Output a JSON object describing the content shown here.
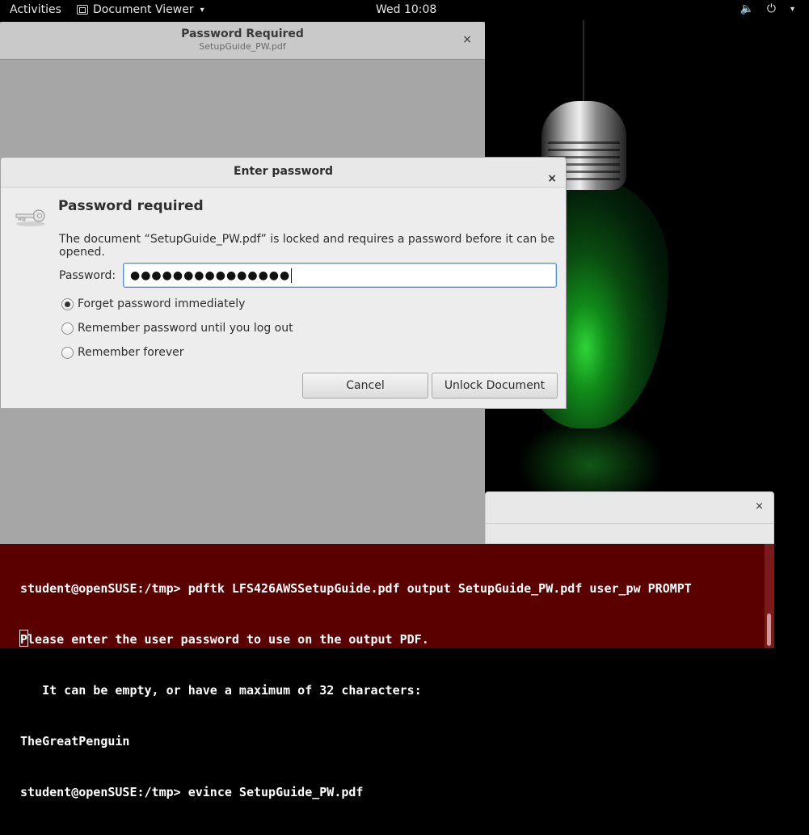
{
  "topbar": {
    "activities": "Activities",
    "app_name": "Document Viewer",
    "app_caret": "▾",
    "clock": "Wed 10:08",
    "volume_icon": "🔈",
    "power_icon": "⏻",
    "menu_caret": "▾"
  },
  "evince": {
    "title": "Password Required",
    "subtitle": "SetupGuide_PW.pdf",
    "close": "×"
  },
  "dialog": {
    "title": "Enter password",
    "close": "×",
    "heading": "Password required",
    "message": "The document “SetupGuide_PW.pdf” is locked and requires a password before it can be opened.",
    "password_label": "Password:",
    "password_value": "●●●●●●●●●●●●●●●",
    "options": [
      {
        "label": "Forget password immediately",
        "checked": true
      },
      {
        "label": "Remember password until you log out",
        "checked": false
      },
      {
        "label": "Remember forever",
        "checked": false
      }
    ],
    "cancel_label": "Cancel",
    "unlock_label": "Unlock Document"
  },
  "terminal": {
    "close": "×",
    "lines": [
      "student@openSUSE:/tmp> pdftk LFS426AWSSetupGuide.pdf output SetupGuide_PW.pdf user_pw PROMPT",
      "Please enter the user password to use on the output PDF.",
      "   It can be empty, or have a maximum of 32 characters:",
      "TheGreatPenguin",
      "student@openSUSE:/tmp> evince SetupGuide_PW.pdf"
    ]
  },
  "colors": {
    "terminal_bg": "#5a0000",
    "focus_border": "#4a90d9"
  }
}
